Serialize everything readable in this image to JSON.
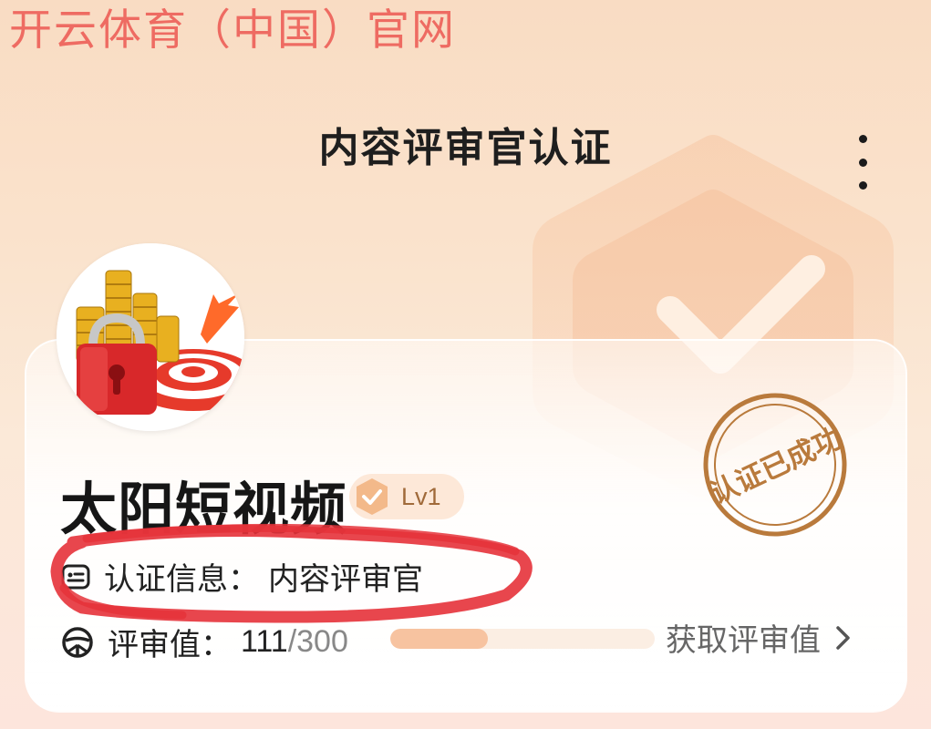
{
  "watermark": {
    "text": "开云体育（中国）官网"
  },
  "header": {
    "title": "内容评审官认证",
    "more_icon": "more-vertical-icon"
  },
  "background_badge": {
    "icon": "hexagon-check-icon"
  },
  "profile": {
    "avatar_icon": "gold-coins-lock-target-image",
    "name": "太阳短视频",
    "level": {
      "icon": "hexagon-check-icon",
      "label": "Lv1"
    },
    "stamp": {
      "text": "认证已成功"
    }
  },
  "certification": {
    "icon": "id-card-icon",
    "label": "认证信息：",
    "value": "内容评审官"
  },
  "review": {
    "icon": "steering-wheel-icon",
    "label": "评审值：",
    "current": "111",
    "separator": "/",
    "total": "300",
    "progress_fraction": 0.37
  },
  "actions": {
    "get_review_label": "获取评审值",
    "get_review_icon": "chevron-right-icon"
  },
  "colors": {
    "accent": "#f7c3a0",
    "stamp": "#b97a3c",
    "annotation": "#e5323a"
  }
}
